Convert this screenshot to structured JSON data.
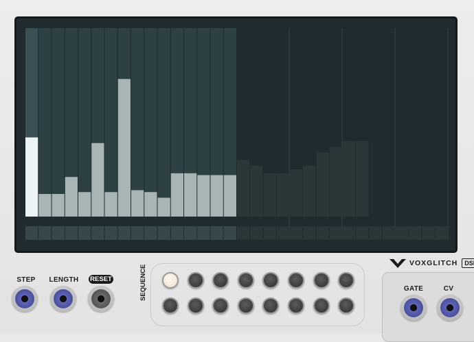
{
  "brand": {
    "name": "VOXGLITCH",
    "module": "DSMC",
    "logo_icon": "voxglitch-v-logo-icon"
  },
  "display": {
    "active_steps": 16,
    "total_steps": 32,
    "current_step": 1,
    "value_max": 1.0,
    "bar_values": [
      0.42,
      0.12,
      0.12,
      0.21,
      0.13,
      0.39,
      0.13,
      0.73,
      0.14,
      0.13,
      0.1,
      0.23,
      0.23,
      0.22,
      0.22,
      0.22,
      0.3,
      0.27,
      0.23,
      0.23,
      0.25,
      0.27,
      0.34,
      0.37,
      0.4,
      0.4
    ],
    "ghost_count": 10,
    "colors": {
      "bg": "#1f2b2e",
      "active_bg": "#2d4044",
      "current_bg": "#3a5055",
      "bar": "#a9b4b5",
      "current_bar": "#ecf3f4",
      "ghost_bar": "#2a3638",
      "gate_lane": "#2b3639"
    }
  },
  "controls": {
    "step_label": "STEP",
    "length_label": "LENGTH",
    "reset_label": "RESET"
  },
  "sequence": {
    "label": "SEQUENCE",
    "buttons": 16,
    "selected_index": 0
  },
  "outputs": {
    "gate_label": "GATE",
    "cv_label": "CV"
  }
}
